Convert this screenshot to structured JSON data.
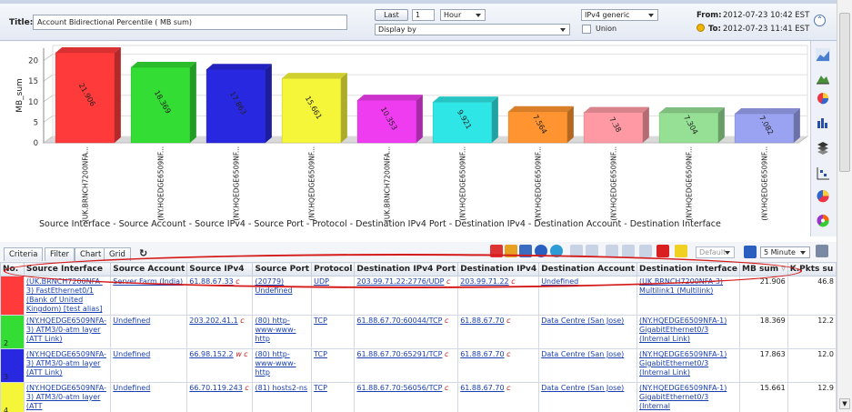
{
  "header": {
    "title_label": "Title:",
    "title_value": "Account Bidirectional Percentile ( MB sum)",
    "last_label": "Last",
    "last_value": "1",
    "unit_value": "Hour",
    "display_by_value": "Display by",
    "ip_version_value": "IPv4 generic",
    "union_label": "Union",
    "from_label": "From:",
    "from_value": "2012-07-23 10:42 EST",
    "to_label": "To:",
    "to_value": "2012-07-23 11:41 EST"
  },
  "chart_data": {
    "type": "bar",
    "ylabel": "MB_sum",
    "ylim": [
      0,
      23
    ],
    "yticks": [
      0,
      5,
      10,
      15,
      20
    ],
    "grid": true,
    "categories": [
      "(UK.BRNCH7200NFA...",
      "(NY.HQEDGE6509NF...",
      "(NY.HQEDGE6509NF...",
      "(NY.HQEDGE6509NF...",
      "(UK.BRNCH7200NFA...",
      "(NY.HQEDGE6509NF...",
      "(NY.HQEDGE6509NF...",
      "(NY.HQEDGE6509NF...",
      "(NY.HQEDGE6509NF...",
      "(NY.HQEDGE6509NF..."
    ],
    "values": [
      21.906,
      18.369,
      17.863,
      15.661,
      10.353,
      9.921,
      7.564,
      7.38,
      7.304,
      7.082
    ],
    "value_labels": [
      "21.906",
      "18.369",
      "17.863",
      "15.661",
      "10.353",
      "9.921",
      "7.564",
      "7.38",
      "7.304",
      "7.082"
    ],
    "colors": [
      "#ff3a3a",
      "#33dd33",
      "#2828e0",
      "#f5f53a",
      "#f03cf0",
      "#2fe6e6",
      "#ff9430",
      "#ff9aa4",
      "#95e095",
      "#9aa2f2"
    ],
    "group_labels": "Source Interface - Source Account - Source IPv4 - Source Port - Protocol - Destination IPv4 Port - Destination IPv4 - Destination Account - Destination Interface"
  },
  "tabs": [
    "Criteria",
    "Filter",
    "Chart",
    "Grid"
  ],
  "toolbar": {
    "default_value": "Default",
    "interval_value": "5 Minute"
  },
  "table": {
    "columns": [
      "No.",
      "Source Interface",
      "Source Account",
      "Source IPv4",
      "Source Port",
      "Protocol",
      "Destination IPv4 Port",
      "Destination IPv4",
      "Destination Account",
      "Destination Interface",
      "MB sum",
      "K.Pkts su"
    ],
    "rows": [
      {
        "no": "",
        "color": "#ff3a3a",
        "src_if": "(UK.BRNCH7200NFA-3) FastEthernet0/1 (Bank of United Kingdom) [test alias]",
        "src_acct": "Server Farm (India)",
        "src_ip": "61.88.67.33",
        "src_ip_mark": "c",
        "src_port": "(20779) Undefined",
        "proto": "UDP",
        "dst_port": "203.99.71.22:2776/UDP",
        "dst_port_mark": "c",
        "dst_ip": "203.99.71.22",
        "dst_ip_mark": "c",
        "dst_acct": "Undefined",
        "dst_if": "(UK.BRNCH7200NFA-3) Multilink1 (Multilink)",
        "mb": "21.906",
        "kp": "46.8"
      },
      {
        "no": "2",
        "color": "#33dd33",
        "src_if": "(NY.HQEDGE6509NFA-3) ATM3/0-atm layer (ATT Link)",
        "src_acct": "Undefined",
        "src_ip": "203.202.41.1",
        "src_ip_mark": "c",
        "src_port": "(80) http-www-www-http",
        "proto": "TCP",
        "dst_port": "61.88.67.70:60044/TCP",
        "dst_port_mark": "c",
        "dst_ip": "61.88.67.70",
        "dst_ip_mark": "c",
        "dst_acct": "Data Centre (San Jose)",
        "dst_if": "(NY.HQEDGE6509NFA-1) GigabitEthernet0/3 (Internal Link)",
        "mb": "18.369",
        "kp": "12.2"
      },
      {
        "no": "3",
        "color": "#2828e0",
        "src_if": "(NY.HQEDGE6509NFA-3) ATM3/0-atm layer (ATT Link)",
        "src_acct": "Undefined",
        "src_ip": "66.98.152.2",
        "src_ip_mark": "w c",
        "src_port": "(80) http-www-www-http",
        "proto": "TCP",
        "dst_port": "61.88.67.70:65291/TCP",
        "dst_port_mark": "c",
        "dst_ip": "61.88.67.70",
        "dst_ip_mark": "c",
        "dst_acct": "Data Centre (San Jose)",
        "dst_if": "(NY.HQEDGE6509NFA-1) GigabitEthernet0/3 (Internal Link)",
        "mb": "17.863",
        "kp": "12.0"
      },
      {
        "no": "4",
        "color": "#f5f53a",
        "src_if": "(NY.HQEDGE6509NFA-3) ATM3/0-atm layer (ATT",
        "src_acct": "Undefined",
        "src_ip": "66.70.119.243",
        "src_ip_mark": "c",
        "src_port": "(81) hosts2-ns",
        "proto": "TCP",
        "dst_port": "61.88.67.70:56056/TCP",
        "dst_port_mark": "c",
        "dst_ip": "61.88.67.70",
        "dst_ip_mark": "c",
        "dst_acct": "Data Centre (San Jose)",
        "dst_if": "(NY.HQEDGE6509NFA-1) GigabitEthernet0/3 (Internal",
        "mb": "15.661",
        "kp": "12.9"
      }
    ]
  }
}
